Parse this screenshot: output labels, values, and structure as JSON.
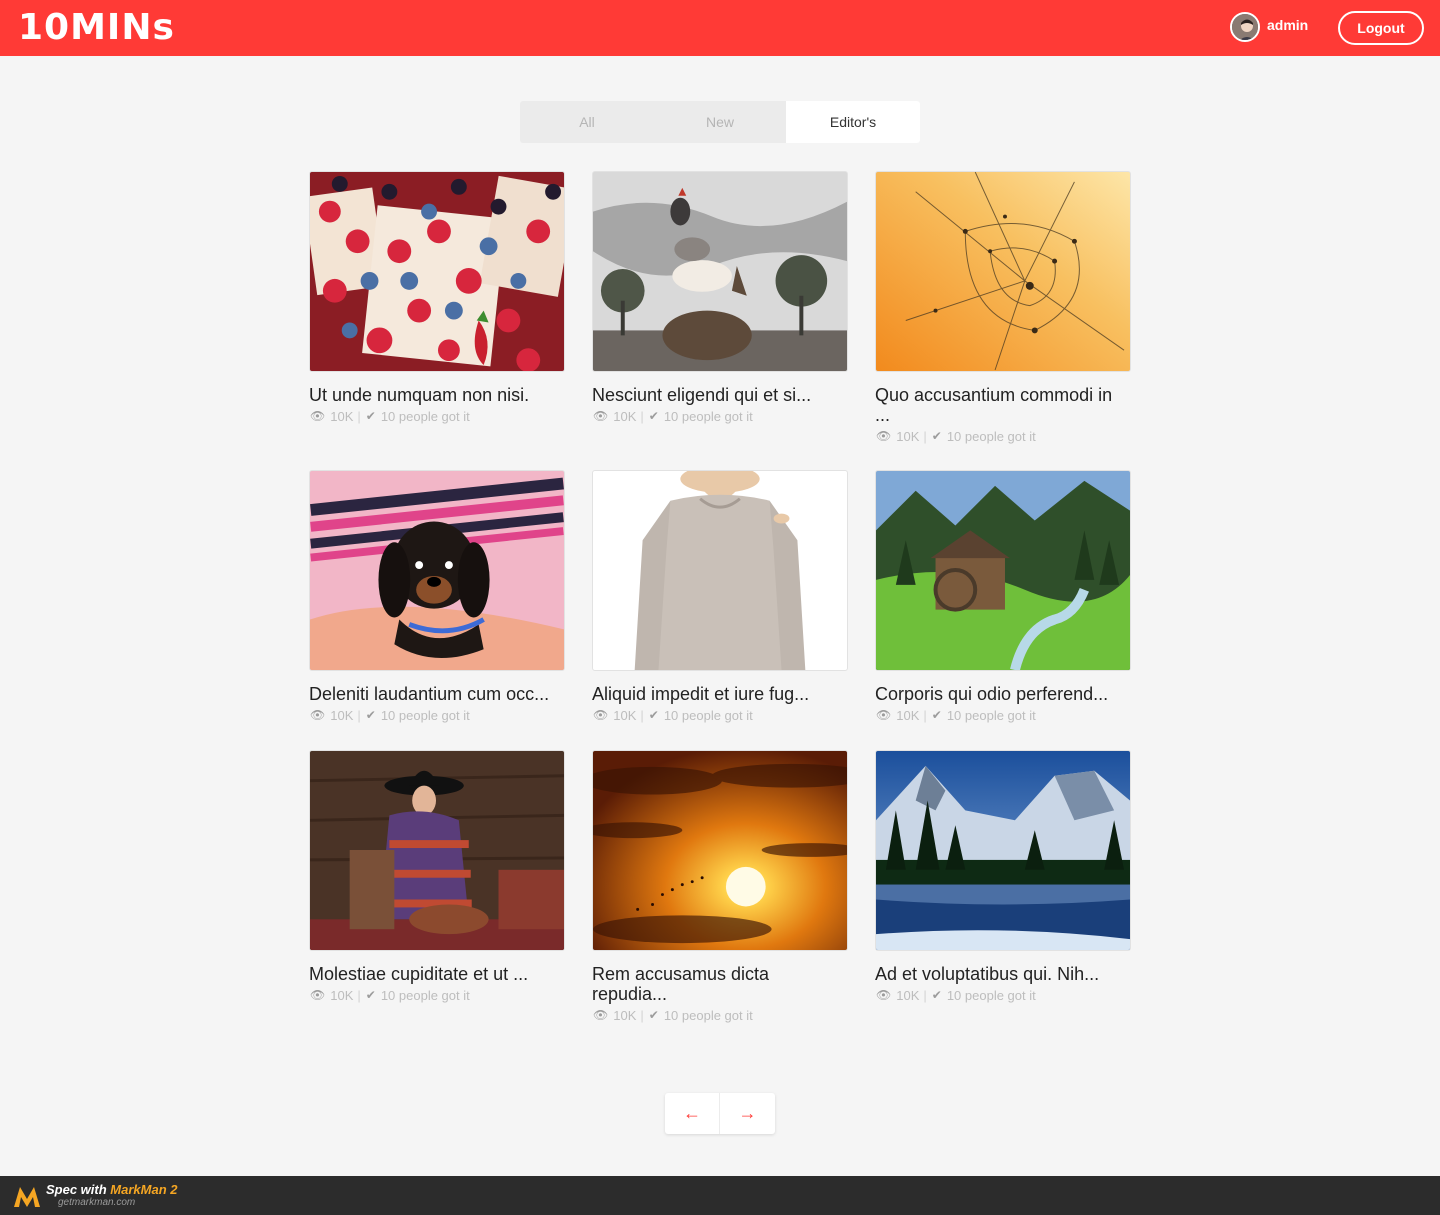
{
  "colors": {
    "brand": "#ff3a36",
    "page_bg": "#f5f5f5",
    "tab_bg": "#ebebeb",
    "active_tab_bg": "#ffffff",
    "meta_text": "#757575"
  },
  "header": {
    "logo": "10MINs",
    "username": "admin",
    "logout_label": "Logout"
  },
  "tabs": [
    {
      "label": "All",
      "active": false
    },
    {
      "label": "New",
      "active": false
    },
    {
      "label": "Editor's",
      "active": true
    }
  ],
  "cards": [
    {
      "title": "Ut unde numquam non nisi.",
      "views": "10K",
      "got_it": "10 people got it",
      "image": "berries"
    },
    {
      "title": "Nesciunt eligendi qui et si...",
      "views": "10K",
      "got_it": "10 people got it",
      "image": "animal-stack"
    },
    {
      "title": "Quo accusantium commodi in ...",
      "views": "10K",
      "got_it": "10 people got it",
      "image": "spider-web"
    },
    {
      "title": "Deleniti laudantium cum occ...",
      "views": "10K",
      "got_it": "10 people got it",
      "image": "puppy"
    },
    {
      "title": "Aliquid impedit et iure fug...",
      "views": "10K",
      "got_it": "10 people got it",
      "image": "sweater"
    },
    {
      "title": "Corporis qui odio perferend...",
      "views": "10K",
      "got_it": "10 people got it",
      "image": "watermill"
    },
    {
      "title": "Molestiae cupiditate et ut ...",
      "views": "10K",
      "got_it": "10 people got it",
      "image": "fashion-model"
    },
    {
      "title": "Rem accusamus dicta repudia...",
      "views": "10K",
      "got_it": "10 people got it",
      "image": "sunset"
    },
    {
      "title": "Ad et voluptatibus qui. Nih...",
      "views": "10K",
      "got_it": "10 people got it",
      "image": "mountain-lake"
    }
  ],
  "icons": {
    "views": "eye-icon",
    "got_it": "check-icon",
    "prev": "arrow-left-icon",
    "next": "arrow-right-icon"
  },
  "footer": {
    "line1_prefix": "Spec with ",
    "line1_brand": "MarkMan 2",
    "line2": "getmarkman.com"
  }
}
